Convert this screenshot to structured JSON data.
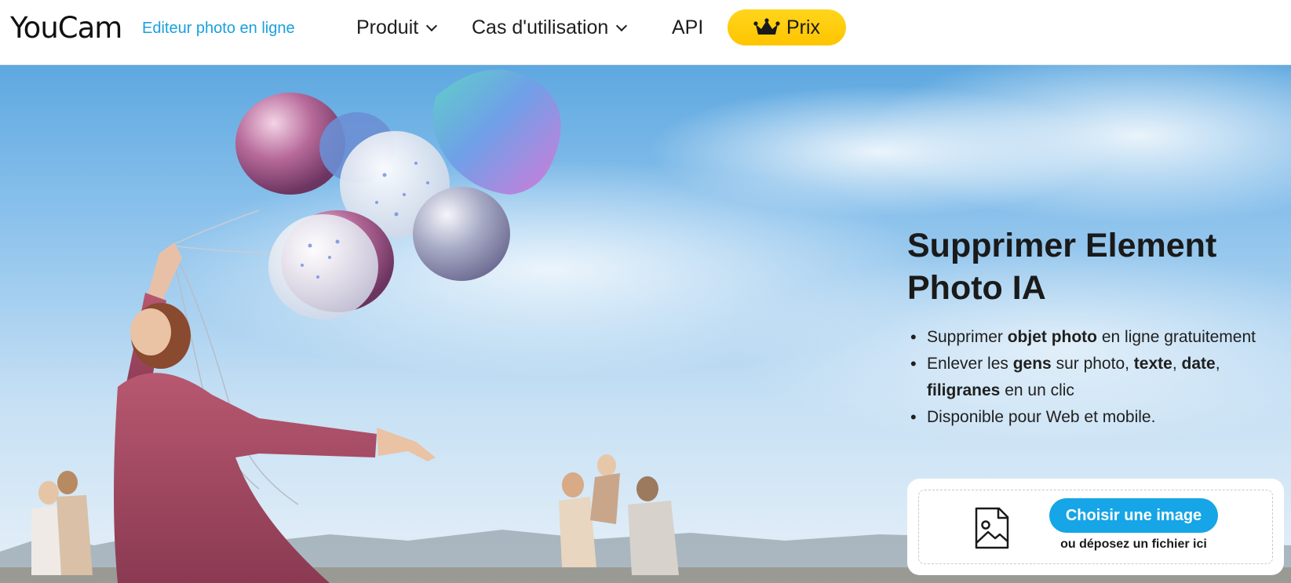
{
  "header": {
    "logo": "YouCam",
    "tagline": "Editeur photo en ligne",
    "nav": [
      {
        "label": "Produit"
      },
      {
        "label": "Cas d'utilisation"
      },
      {
        "label": "API"
      }
    ],
    "pricing_label": "Prix"
  },
  "hero": {
    "title": "Supprimer Element Photo IA",
    "features": [
      {
        "parts": [
          "Supprimer ",
          "objet photo",
          " en ligne gratuitement"
        ]
      },
      {
        "parts": [
          "Enlever les ",
          "gens",
          " sur photo, ",
          "texte",
          ", ",
          "date",
          ", ",
          "filigranes",
          " en un clic"
        ]
      },
      {
        "parts": [
          "Disponible pour Web et mobile."
        ]
      }
    ]
  },
  "upload": {
    "button_label": "Choisir une image",
    "drop_hint": "ou déposez un fichier ici"
  },
  "colors": {
    "accent": "#16a5e6",
    "pricing": "#ffcc00",
    "tagline": "#1aa0dc"
  }
}
